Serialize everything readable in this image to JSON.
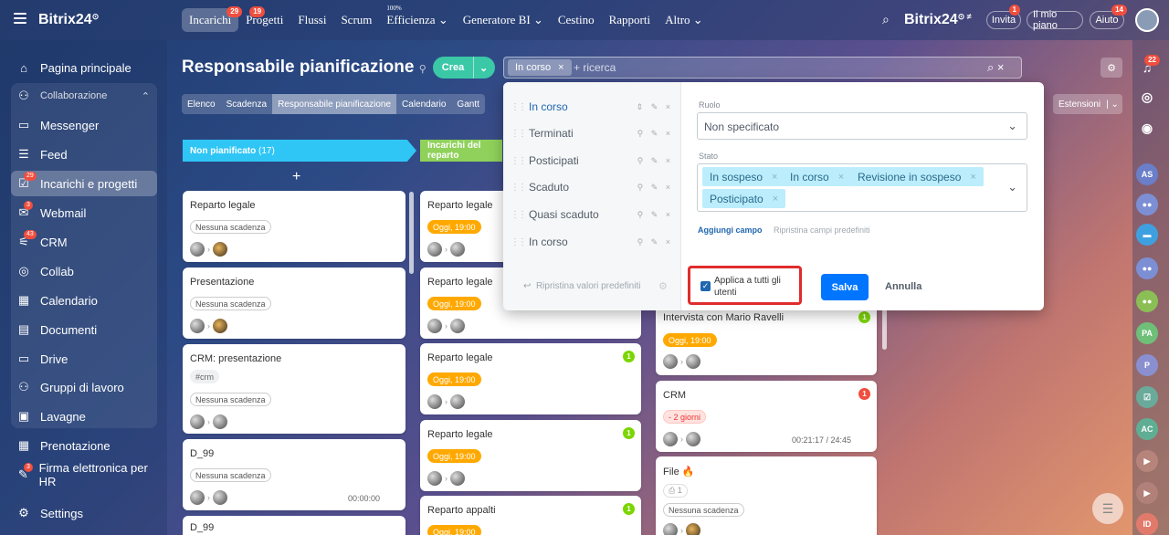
{
  "brand": {
    "name": "Bitrix24"
  },
  "topnav": {
    "items": [
      {
        "label": "Incarichi",
        "badge": "29"
      },
      {
        "label": "Progetti",
        "badge": "19"
      },
      {
        "label": "Flussi"
      },
      {
        "label": "Scrum"
      },
      {
        "label": "Efficienza ⌄",
        "sup": "100%"
      },
      {
        "label": "Generatore BI ⌄"
      },
      {
        "label": "Cestino"
      },
      {
        "label": "Rapporti"
      },
      {
        "label": "Altro ⌄"
      }
    ],
    "brand_right": "Bitrix24",
    "invita": "Invita",
    "invita_badge": "1",
    "mio_piano": "Il mio piano",
    "aiuto": "Aiuto",
    "aiuto_badge": "14"
  },
  "sidebar": {
    "items": [
      {
        "label": "Pagina principale",
        "icon": "home-icon"
      },
      {
        "label": "Collaborazione",
        "icon": "collab-icon"
      },
      {
        "label": "Messenger",
        "icon": "chat-icon"
      },
      {
        "label": "Feed",
        "icon": "feed-icon"
      },
      {
        "label": "Incarichi e progetti",
        "icon": "tasks-icon",
        "badge": "29"
      },
      {
        "label": "Webmail",
        "icon": "mail-icon",
        "badge": "3"
      },
      {
        "label": "CRM",
        "icon": "crm-icon",
        "badge": "43"
      },
      {
        "label": "Collab",
        "icon": "collab-circle-icon"
      },
      {
        "label": "Calendario",
        "icon": "calendar-icon"
      },
      {
        "label": "Documenti",
        "icon": "docs-icon"
      },
      {
        "label": "Drive",
        "icon": "drive-icon"
      },
      {
        "label": "Gruppi di lavoro",
        "icon": "groups-icon"
      },
      {
        "label": "Lavagne",
        "icon": "board-icon"
      },
      {
        "label": "Prenotazione",
        "icon": "booking-icon"
      },
      {
        "label": "Firma elettronica per HR",
        "icon": "sign-icon",
        "badge": "3"
      },
      {
        "label": "Settings",
        "icon": "settings-icon"
      }
    ]
  },
  "page": {
    "title": "Responsabile pianificazione",
    "crea": "Crea",
    "search_chip": "In corso",
    "search_placeholder": "+ ricerca",
    "tabs": [
      "Elenco",
      "Scadenza",
      "Responsabile pianificazione",
      "Calendario",
      "Gantt"
    ],
    "estensioni": "Estensioni"
  },
  "columns": [
    {
      "title": "Non pianificato",
      "count": "(17)",
      "add": "+"
    },
    {
      "title": "Incarichi del reparto"
    }
  ],
  "col1_cards": [
    {
      "title": "Reparto legale",
      "tag": "Nessuna scadenza"
    },
    {
      "title": "Presentazione",
      "tag": "Nessuna scadenza"
    },
    {
      "title": "CRM: presentazione",
      "hashtag": "#crm",
      "tag": "Nessuna scadenza"
    },
    {
      "title": "D_99",
      "tag": "Nessuna scadenza",
      "time": "00:00:00"
    },
    {
      "title": "D_99"
    }
  ],
  "col2_cards": [
    {
      "title": "Reparto legale",
      "tag": "Oggi, 19:00"
    },
    {
      "title": "Reparto legale",
      "tag": "Oggi, 19:00"
    },
    {
      "title": "Reparto legale",
      "tag": "Oggi, 19:00",
      "count": "1"
    },
    {
      "title": "Reparto legale",
      "tag": "Oggi, 19:00",
      "count": "1"
    },
    {
      "title": "Reparto appalti",
      "tag": "Oggi, 19:00",
      "count": "1"
    }
  ],
  "col3_cards": [
    {
      "title": "Intervista con Mario Ravelli",
      "tag": "Oggi, 19:00",
      "count": "1"
    },
    {
      "title": "CRM",
      "tag": "- 2 giorni",
      "count": "1",
      "time": "00:21:17 / 24:45"
    },
    {
      "title": "File 🔥",
      "sub": "⎙ 1",
      "tag": "Nessuna scadenza"
    }
  ],
  "filter": {
    "presets": [
      "In corso",
      "Terminati",
      "Posticipati",
      "Scaduto",
      "Quasi scaduto",
      "In corso"
    ],
    "reset_presets": "Ripristina valori predefiniti",
    "ruolo_label": "Ruolo",
    "ruolo_value": "Non specificato",
    "stato_label": "Stato",
    "stato_values": [
      "In sospeso",
      "In corso",
      "Revisione in sospeso",
      "Posticipato"
    ],
    "add_field": "Aggiungi campo",
    "reset_fields": "Ripristina campi predefiniti",
    "apply_all": "Applica a tutti gli utenti",
    "save": "Salva",
    "cancel": "Annulla"
  },
  "rightbar": {
    "badge": "22",
    "avatars": [
      "AS",
      "PA",
      "P",
      "AC",
      "ID"
    ]
  }
}
